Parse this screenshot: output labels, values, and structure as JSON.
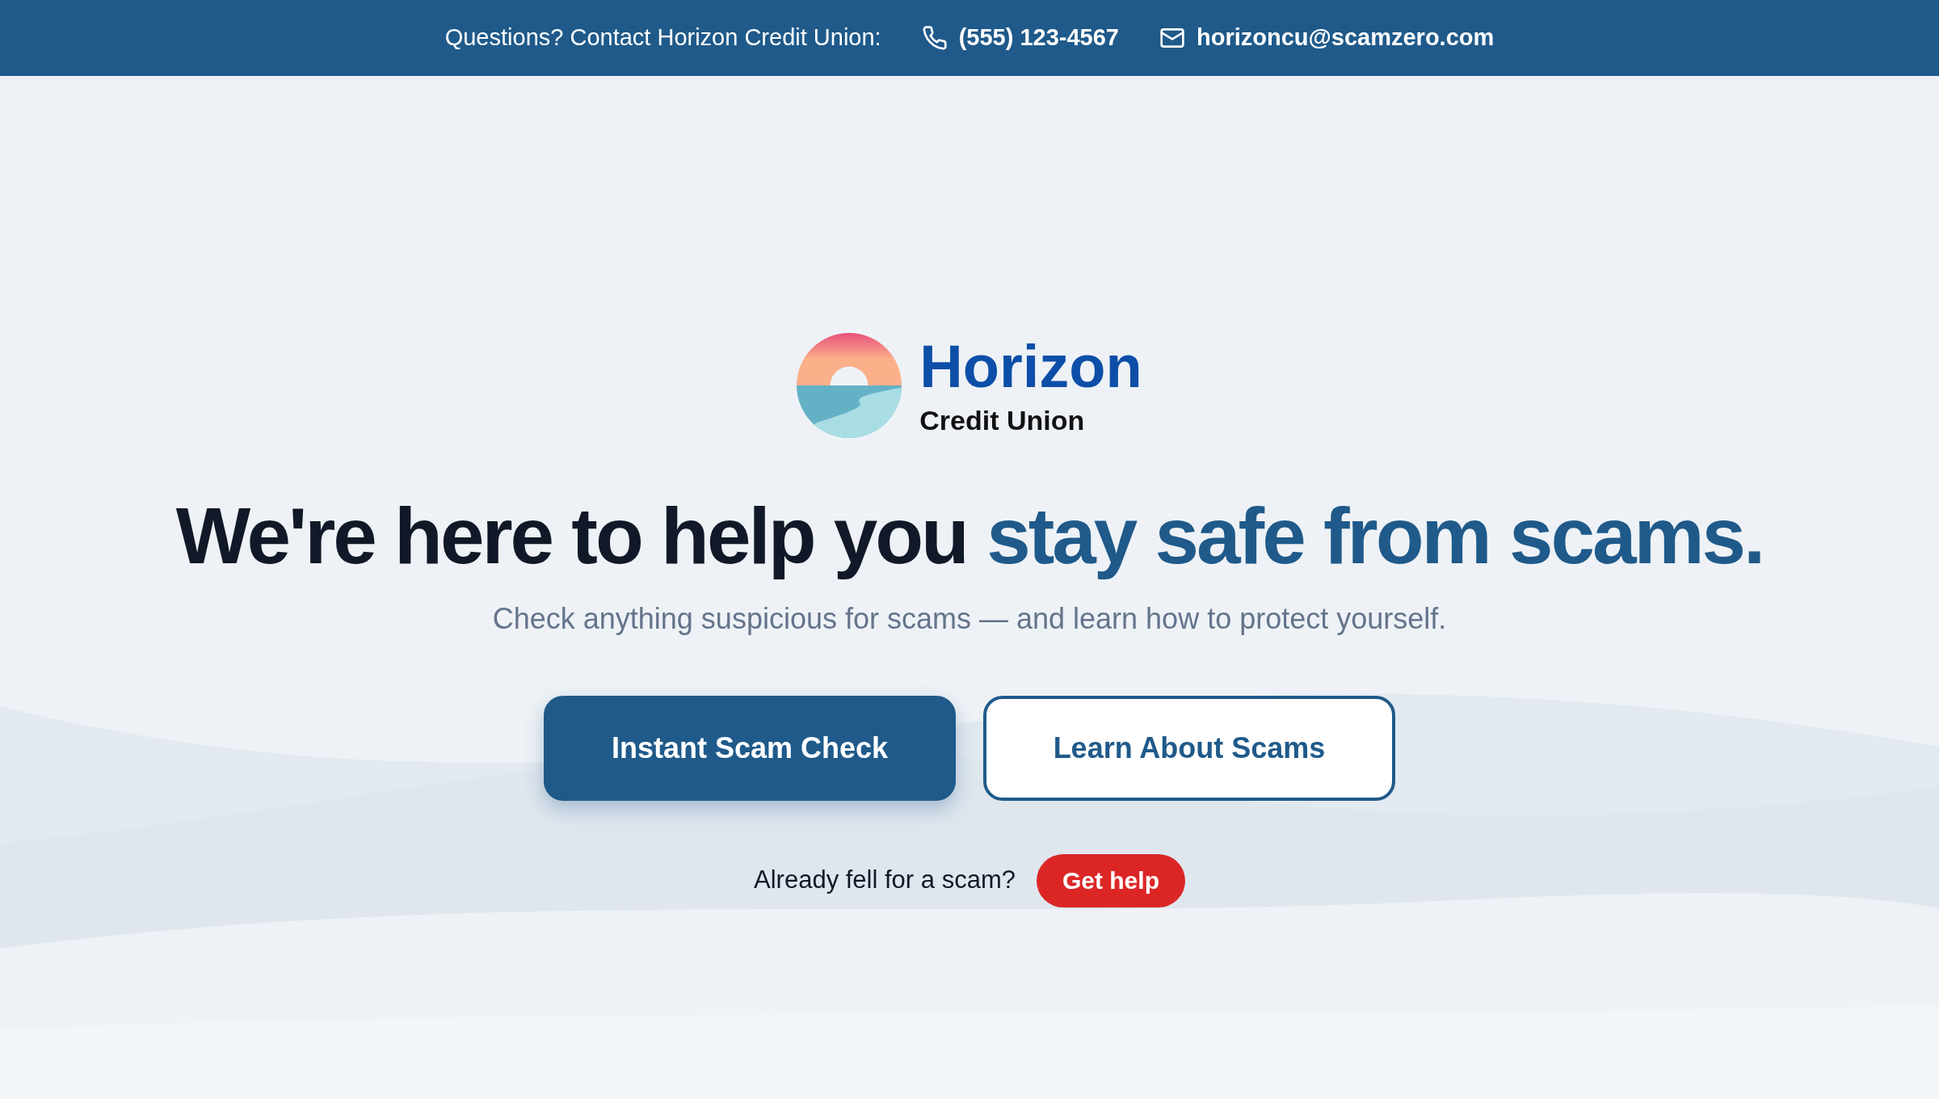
{
  "top_bar": {
    "label": "Questions? Contact Horizon Credit Union:",
    "phone": "(555) 123-4567",
    "email": "horizoncu@scamzero.com"
  },
  "logo": {
    "name": "Horizon",
    "subtitle": "Credit Union"
  },
  "hero": {
    "heading": "We're here to help you ",
    "heading_highlight": "stay safe from scams.",
    "subtitle": "Check anything suspicious for scams — and learn how to protect yourself."
  },
  "buttons": [
    {
      "label": "Instant Scam Check",
      "kind": "primary"
    },
    {
      "label": "Learn About Scams",
      "kind": "outline"
    }
  ],
  "help": {
    "text": "Already fell for a scam?",
    "button": "Get help"
  }
}
